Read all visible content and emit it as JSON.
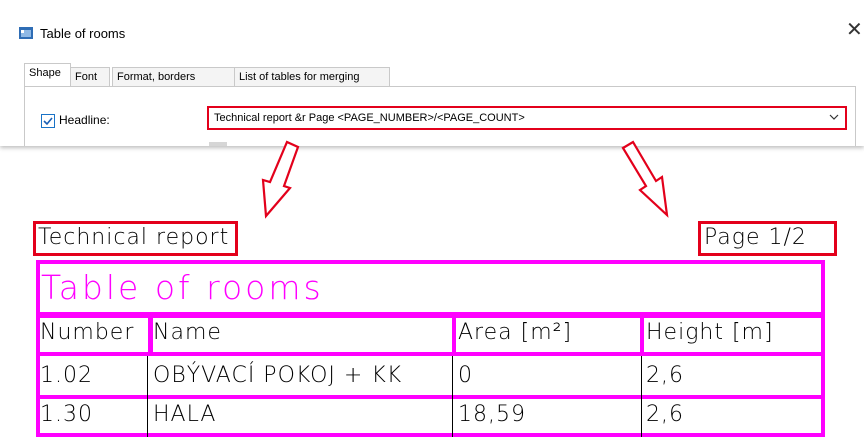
{
  "dialog": {
    "title": "Table of rooms",
    "close_glyph": "✕",
    "tabs": [
      {
        "label": "Shape",
        "active": true
      },
      {
        "label": "Font",
        "active": false
      },
      {
        "label": "Format, borders",
        "active": false
      },
      {
        "label": "List of tables for merging",
        "active": false
      }
    ],
    "headline": {
      "label": "Headline:",
      "checked": true,
      "value": "Technical report &r Page <PAGE_NUMBER>/<PAGE_COUNT>"
    }
  },
  "preview": {
    "left_label": "Technical report",
    "right_label": "Page 1/2",
    "table": {
      "title": "Table of rooms",
      "columns": [
        "Number",
        "Name",
        "Area [m²]",
        "Height [m]"
      ],
      "rows": [
        [
          "1.02",
          "OBÝVACÍ POKOJ + KK",
          "0",
          "2,6"
        ],
        [
          "1.30",
          "HALA",
          "18,59",
          "2,6"
        ]
      ]
    }
  },
  "colors": {
    "highlight_red": "#e3001b",
    "table_magenta": "#ff00ff"
  },
  "icons": {
    "app": "table-window-icon",
    "close": "close-icon",
    "dropdown": "chevron-down-icon",
    "arrows": "hollow-arrow-icon"
  }
}
